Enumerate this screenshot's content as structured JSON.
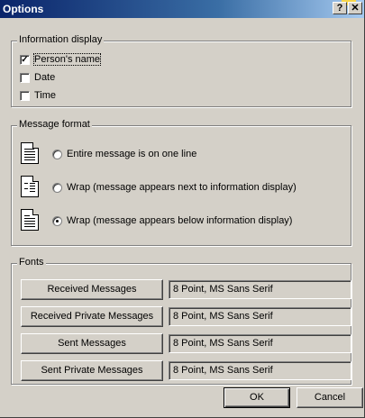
{
  "window": {
    "title": "Options",
    "help_label": "?",
    "close_label": "✕"
  },
  "info_display": {
    "legend": "Information display",
    "items": [
      {
        "label": "Person's name",
        "checked": true
      },
      {
        "label": "Date",
        "checked": false
      },
      {
        "label": "Time",
        "checked": false
      }
    ]
  },
  "message_format": {
    "legend": "Message format",
    "options": [
      {
        "label": "Entire message is on one line",
        "selected": false,
        "icon": "one-line-doc-icon"
      },
      {
        "label": "Wrap (message appears next to information display)",
        "selected": false,
        "icon": "wrap-beside-doc-icon"
      },
      {
        "label": "Wrap (message appears below information display)",
        "selected": true,
        "icon": "wrap-below-doc-icon"
      }
    ]
  },
  "fonts": {
    "legend": "Fonts",
    "rows": [
      {
        "button": "Received Messages",
        "value": "8 Point, MS Sans Serif"
      },
      {
        "button": "Received Private Messages",
        "value": "8 Point, MS Sans Serif"
      },
      {
        "button": "Sent Messages",
        "value": "8 Point, MS Sans Serif"
      },
      {
        "button": "Sent Private Messages",
        "value": "8 Point, MS Sans Serif"
      }
    ]
  },
  "footer": {
    "ok_label": "OK",
    "cancel_label": "Cancel"
  },
  "colors": {
    "titlebar_start": "#0a246a",
    "titlebar_end": "#a6caf0",
    "face": "#d4d0c8"
  }
}
